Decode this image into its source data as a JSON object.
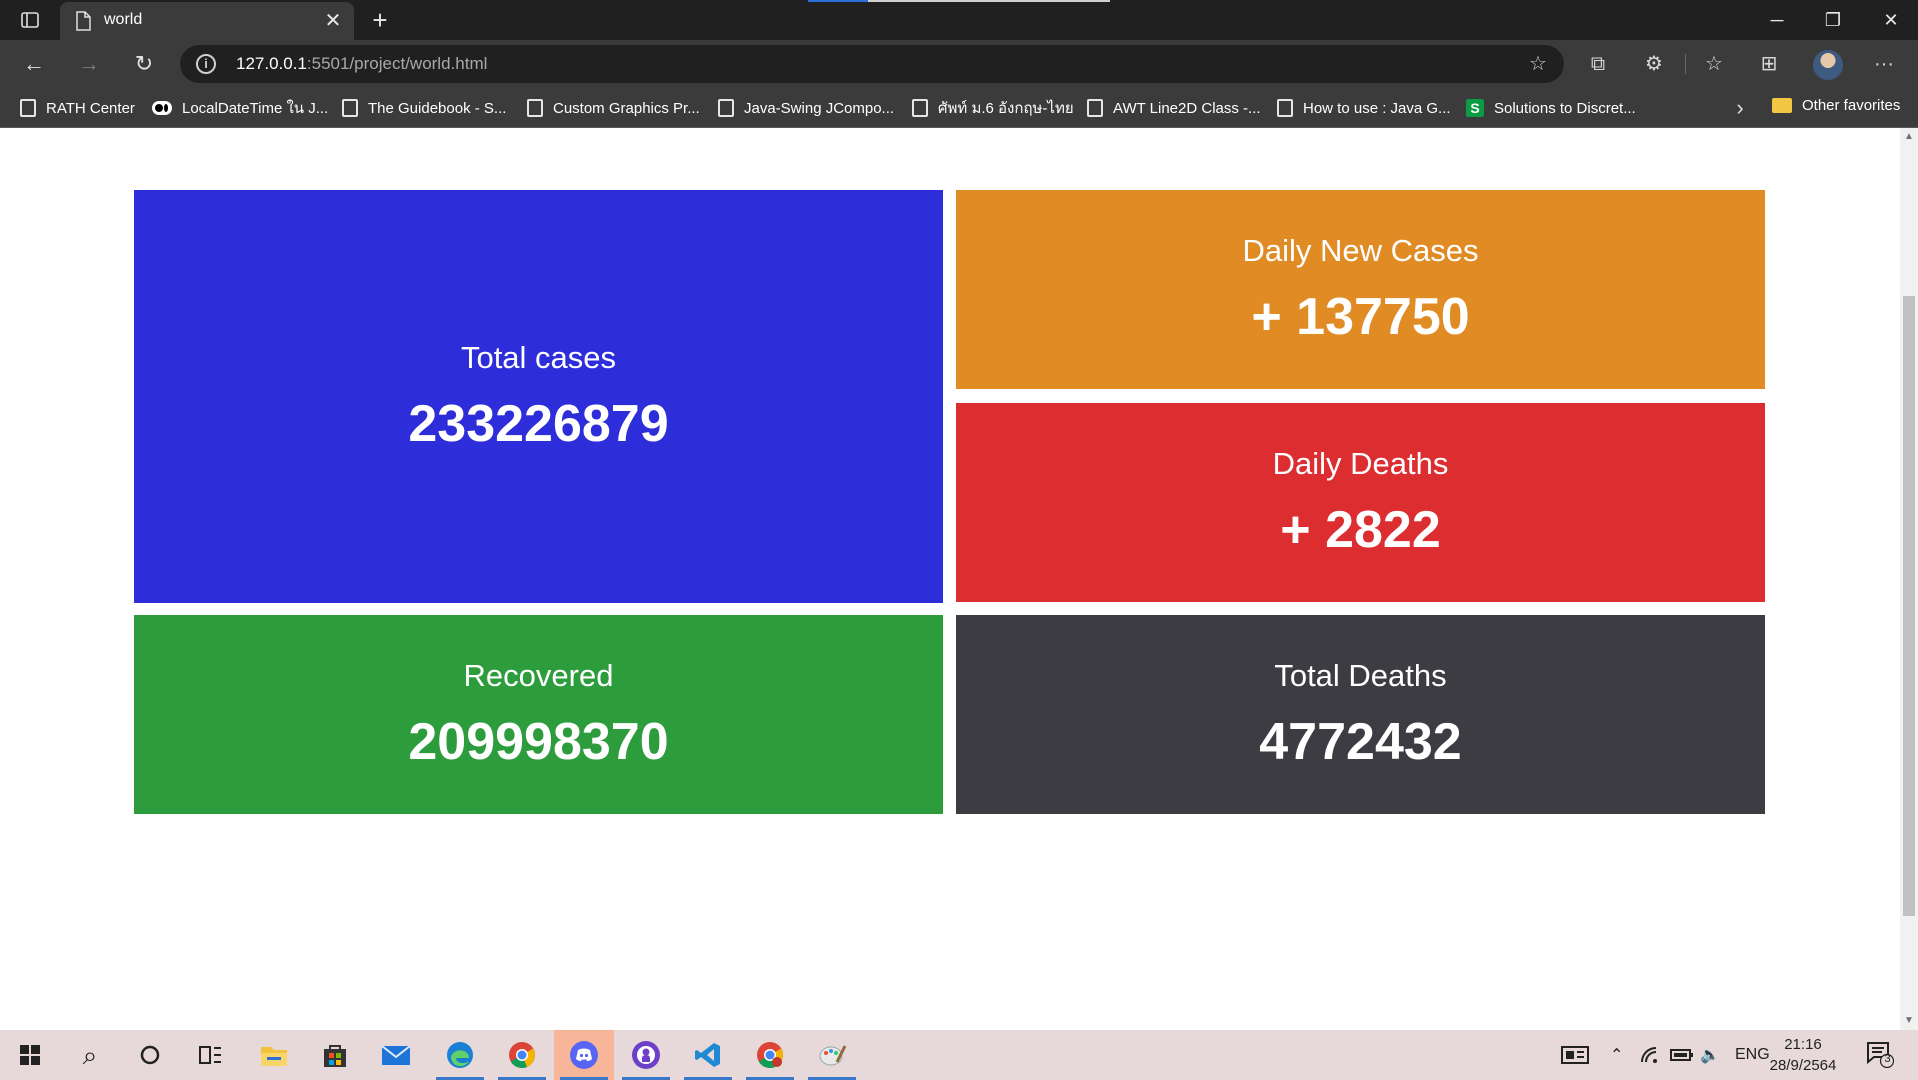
{
  "browser": {
    "tab_title": "world",
    "url_host": "127.0.0.1",
    "url_rest": ":5501/project/world.html",
    "bookmarks": [
      {
        "label": "RATH Center",
        "icon": "document-icon"
      },
      {
        "label": "LocalDateTime ใน J...",
        "icon": "medium-icon"
      },
      {
        "label": "The Guidebook - S...",
        "icon": "document-icon"
      },
      {
        "label": "Custom Graphics Pr...",
        "icon": "document-icon"
      },
      {
        "label": "Java-Swing JCompo...",
        "icon": "document-icon"
      },
      {
        "label": "ศัพท์ ม.6 อังกฤษ-ไทย",
        "icon": "document-icon"
      },
      {
        "label": "AWT Line2D Class -...",
        "icon": "document-icon"
      },
      {
        "label": "How to use : Java G...",
        "icon": "document-icon"
      },
      {
        "label": "Solutions to Discret...",
        "icon": "slader-icon"
      }
    ],
    "other_favorites": "Other favorites"
  },
  "page": {
    "cards": {
      "total_cases": {
        "label": "Total cases",
        "value": "233226879",
        "color": "#2d2ed9"
      },
      "daily_new_cases": {
        "label": "Daily New Cases",
        "value": "+ 137750",
        "color": "#e08b24"
      },
      "daily_deaths": {
        "label": "Daily Deaths",
        "value": "+ 2822",
        "color": "#dc2d30"
      },
      "recovered": {
        "label": "Recovered",
        "value": "209998370",
        "color": "#2d9c3c"
      },
      "total_deaths": {
        "label": "Total Deaths",
        "value": "4772432",
        "color": "#3d3c42"
      }
    }
  },
  "taskbar": {
    "language": "ENG",
    "time": "21:16",
    "date": "28/9/2564",
    "notification_count": "3"
  }
}
